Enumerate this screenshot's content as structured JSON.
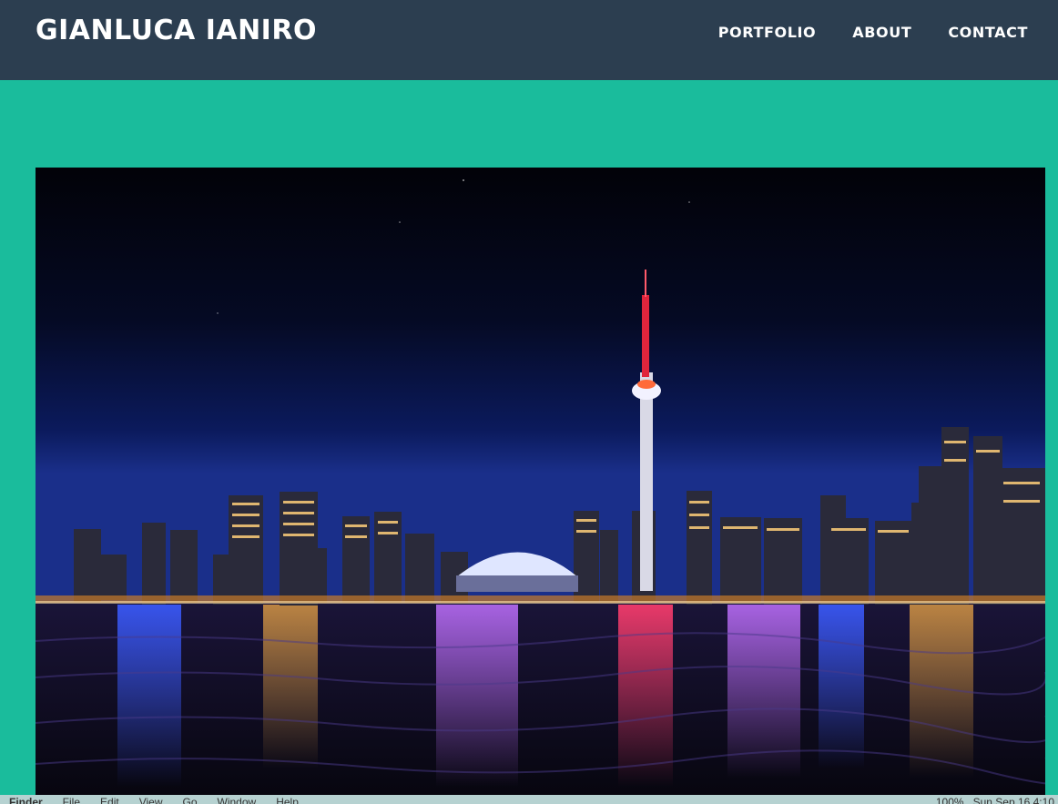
{
  "navbar": {
    "brand": "GIANLUCA IANIRO",
    "links": [
      "PORTFOLIO",
      "ABOUT",
      "CONTACT"
    ]
  },
  "hero": {
    "icon": "city-skyline-night-photo"
  },
  "menubar": {
    "items": [
      "Finder",
      "File",
      "Edit",
      "View",
      "Go",
      "Window",
      "Help"
    ],
    "battery": "100%",
    "clock": "Sun Sep 16 4:10"
  },
  "colors": {
    "navbar_bg": "#2c3e50",
    "page_bg": "#1abc9c",
    "nav_text": "#ffffff"
  }
}
